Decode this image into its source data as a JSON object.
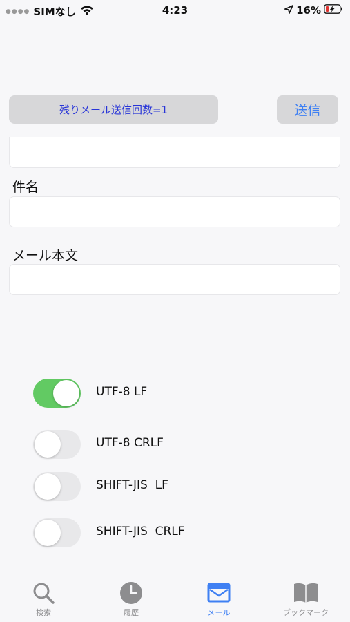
{
  "status_bar": {
    "carrier": "SIMなし",
    "time": "4:23",
    "battery": "16%"
  },
  "actions": {
    "remaining_label": "残りメール送信回数=1",
    "send_label": "送信"
  },
  "form": {
    "subject_label": "件名",
    "body_label": "メール本文",
    "address_value": "",
    "subject_value": "",
    "body_value": ""
  },
  "encodings": [
    {
      "label": "UTF-8 LF",
      "on": true
    },
    {
      "label": "UTF-8 CRLF",
      "on": false
    },
    {
      "label": "SHIFT-JIS  LF",
      "on": false
    },
    {
      "label": "SHIFT-JIS  CRLF",
      "on": false
    }
  ],
  "tabs": [
    {
      "label": "検索",
      "icon": "search-icon"
    },
    {
      "label": "履歴",
      "icon": "clock-icon"
    },
    {
      "label": "メール",
      "icon": "mail-icon"
    },
    {
      "label": "ブックマーク",
      "icon": "bookmarks-icon"
    }
  ],
  "colors": {
    "accent": "#3f80f3",
    "toggle_on": "#62ca63",
    "remaining_text": "#2734d8"
  }
}
